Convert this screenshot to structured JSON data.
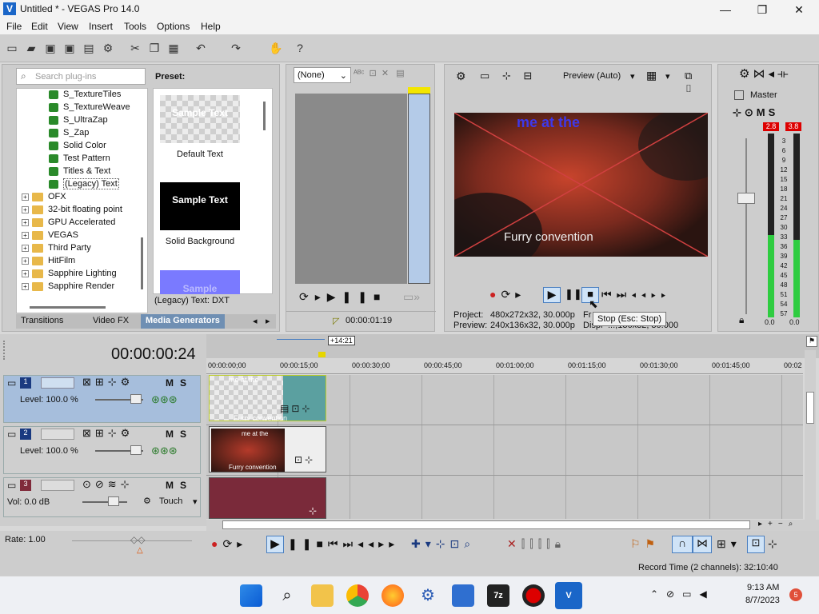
{
  "window": {
    "title": "Untitled * - VEGAS Pro 14.0",
    "controls": [
      "—",
      "❐",
      "✕"
    ]
  },
  "menu": [
    "File",
    "Edit",
    "View",
    "Insert",
    "Tools",
    "Options",
    "Help"
  ],
  "plugins": {
    "search_placeholder": "Search plug-ins",
    "items": [
      {
        "label": "S_TextureTiles",
        "type": "plugin"
      },
      {
        "label": "S_TextureWeave",
        "type": "plugin"
      },
      {
        "label": "S_UltraZap",
        "type": "plugin"
      },
      {
        "label": "S_Zap",
        "type": "plugin"
      },
      {
        "label": "Solid Color",
        "type": "plugin"
      },
      {
        "label": "Test Pattern",
        "type": "plugin"
      },
      {
        "label": "Titles & Text",
        "type": "plugin"
      },
      {
        "label": "(Legacy) Text",
        "type": "plugin"
      },
      {
        "label": "OFX",
        "type": "folder"
      },
      {
        "label": "32-bit floating point",
        "type": "folder"
      },
      {
        "label": "GPU Accelerated",
        "type": "folder"
      },
      {
        "label": "VEGAS",
        "type": "folder"
      },
      {
        "label": "Third Party",
        "type": "folder"
      },
      {
        "label": "HitFilm",
        "type": "folder"
      },
      {
        "label": "Sapphire Lighting",
        "type": "folder"
      },
      {
        "label": "Sapphire Render",
        "type": "folder"
      }
    ],
    "preset_heading": "Preset:",
    "presets": [
      {
        "thumb_text": "Sample Text",
        "label": "Default Text"
      },
      {
        "thumb_text": "Sample Text",
        "label": "Solid Background"
      },
      {
        "thumb_text": "Sample",
        "label": ""
      }
    ],
    "footer": "(Legacy) Text: DXT",
    "tabs": [
      "Transitions",
      "Video FX",
      "Media Generators"
    ]
  },
  "trimmer": {
    "select_value": "(None)",
    "timecode": "00:00:01:19"
  },
  "preview": {
    "mode_label": "Preview (Auto)",
    "overlay_text": {
      "top": "me at the",
      "bottom": "Furry convention"
    },
    "project_label": "Project:",
    "project_value": "480x272x32, 30.000p",
    "preview_label": "Preview:",
    "preview_value": "240x136x32, 30.000p",
    "frame_label": "Fr",
    "display_label": "Displ",
    "display_value": "...,136x32, 30.000",
    "tooltip": "Stop (Esc: Stop)"
  },
  "master": {
    "label": "Master",
    "peak_left": "2.8",
    "peak_right": "3.8",
    "scale": [
      "3",
      "6",
      "9",
      "12",
      "15",
      "18",
      "21",
      "24",
      "27",
      "30",
      "33",
      "36",
      "39",
      "42",
      "45",
      "48",
      "51",
      "54",
      "57"
    ],
    "bottom_left": "0.0",
    "bottom_right": "0.0",
    "level_left": 0.45,
    "level_right": 0.42
  },
  "timeline": {
    "timecode": "00:00:00:24",
    "cursor_offset": "+14:21",
    "ruler": [
      "00:00:00;00",
      "00:00:15;00",
      "00:00:30;00",
      "00:00:45;00",
      "00:01:00;00",
      "00:01:15;00",
      "00:01:30;00",
      "00:01:45;00",
      "00:02"
    ],
    "tracks": [
      {
        "num": "1",
        "level": "Level: 100.0 %",
        "type": "video"
      },
      {
        "num": "2",
        "level": "Level: 100.0 %",
        "type": "video"
      },
      {
        "num": "3",
        "level": "Vol:      0.0 dB",
        "type": "audio",
        "mode": "Touch"
      }
    ],
    "clip_texts": {
      "c1_top": "me at the",
      "c1_bottom": "Furry convention",
      "c2_top": "me at the",
      "c2_bottom": "Furry convention"
    },
    "rate": "Rate: 1.00",
    "record_time": "Record Time (2 channels): 32:10:40"
  },
  "taskbar": {
    "time": "9:13 AM",
    "date": "8/7/2023",
    "badge": "5"
  }
}
